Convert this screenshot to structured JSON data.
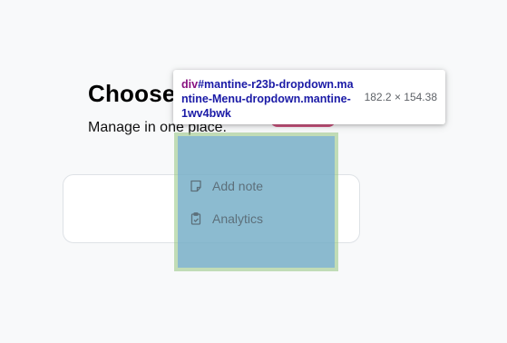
{
  "page": {
    "title": "Choose",
    "subtitle": "Manage in one place."
  },
  "menu": {
    "items": [
      {
        "label": "Add note",
        "icon": "note-icon"
      },
      {
        "label": "Analytics",
        "icon": "clipboard-icon"
      }
    ]
  },
  "inspector": {
    "tag": "div",
    "selector": "#mantine-r23b-dropdown.mantine-Menu-dropdown.mantine-1wv4bwk",
    "dimensions": "182.2 × 154.38"
  },
  "colors": {
    "accent": "#c73a6a",
    "overlay_content": "#6fa8dc",
    "overlay_padding": "#93c47d"
  }
}
